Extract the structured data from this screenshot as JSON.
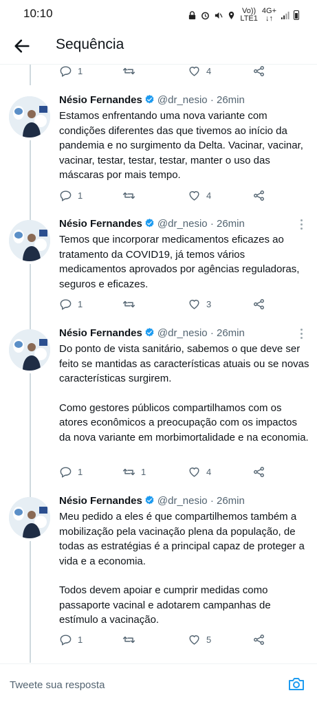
{
  "status_bar": {
    "time": "10:10",
    "network_top": "Vo))",
    "network_bottom": "LTE1",
    "network2_top": "4G+",
    "network2_bottom": "↓↑"
  },
  "header": {
    "title": "Sequência",
    "back_icon": "arrow-left-icon"
  },
  "tweets": [
    {
      "name": "Nésio Fernandes",
      "handle": "@dr_nesio",
      "time": "26min",
      "separator": "·",
      "paragraphs": [
        "Estamos enfrentando uma nova variante com condições diferentes das que tivemos ao início da pandemia e no surgimento da Delta. Vacinar, vacinar, vacinar, testar, testar, testar, manter o uso das máscaras por mais tempo."
      ],
      "replies": "1",
      "retweets": "",
      "likes": "4"
    },
    {
      "name": "Nésio Fernandes",
      "handle": "@dr_nesio",
      "time": "26min",
      "separator": "·",
      "paragraphs": [
        "Temos que incorporar medicamentos eficazes ao tratamento da COVID19, já temos vários medicamentos aprovados por agências reguladoras, seguros e eficazes."
      ],
      "replies": "1",
      "retweets": "",
      "likes": "3"
    },
    {
      "name": "Nésio Fernandes",
      "handle": "@dr_nesio",
      "time": "26min",
      "separator": "·",
      "paragraphs": [
        "Do ponto de vista sanitário, sabemos o que deve ser feito se mantidas as características atuais ou se novas características surgirem.",
        "Como gestores públicos compartilhamos com os atores econômicos a preocupação com os impactos da nova variante em morbimortalidade e na economia."
      ],
      "replies": "1",
      "retweets": "1",
      "likes": "4"
    },
    {
      "name": "Nésio Fernandes",
      "handle": "@dr_nesio",
      "time": "26min",
      "separator": "·",
      "paragraphs": [
        "Meu pedido a eles é que compartilhemos também a mobilização pela vacinação plena da população, de todas as estratégias é a principal capaz de proteger a vida e a economia.",
        "Todos devem apoiar e cumprir medidas como passaporte vacinal e adotarem campanhas de estímulo a vacinação."
      ],
      "replies": "1",
      "retweets": "",
      "likes": "5"
    }
  ],
  "top_partial_actions": {
    "replies": "1",
    "retweets": "",
    "likes": "4"
  },
  "reply_box": {
    "placeholder": "Tweete sua resposta",
    "camera_icon": "camera-icon"
  },
  "colors": {
    "text": "#0f1419",
    "secondary": "#536471",
    "verified": "#1d9bf0",
    "camera": "#1d9bf0",
    "thread_line": "#cfd9de"
  }
}
